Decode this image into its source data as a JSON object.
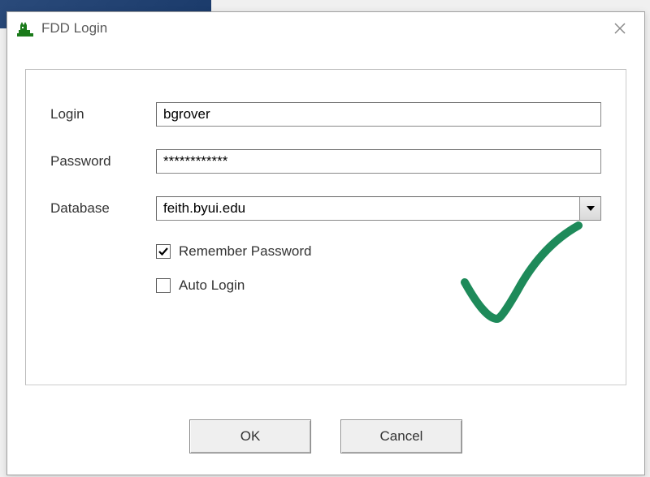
{
  "window": {
    "title": "FDD Login"
  },
  "form": {
    "login_label": "Login",
    "login_value": "bgrover",
    "password_label": "Password",
    "password_value": "************",
    "database_label": "Database",
    "database_value": "feith.byui.edu",
    "remember_label": "Remember Password",
    "remember_checked": true,
    "autologin_label": "Auto Login",
    "autologin_checked": false
  },
  "buttons": {
    "ok": "OK",
    "cancel": "Cancel"
  },
  "annotation": {
    "color": "#1e8a5a"
  }
}
